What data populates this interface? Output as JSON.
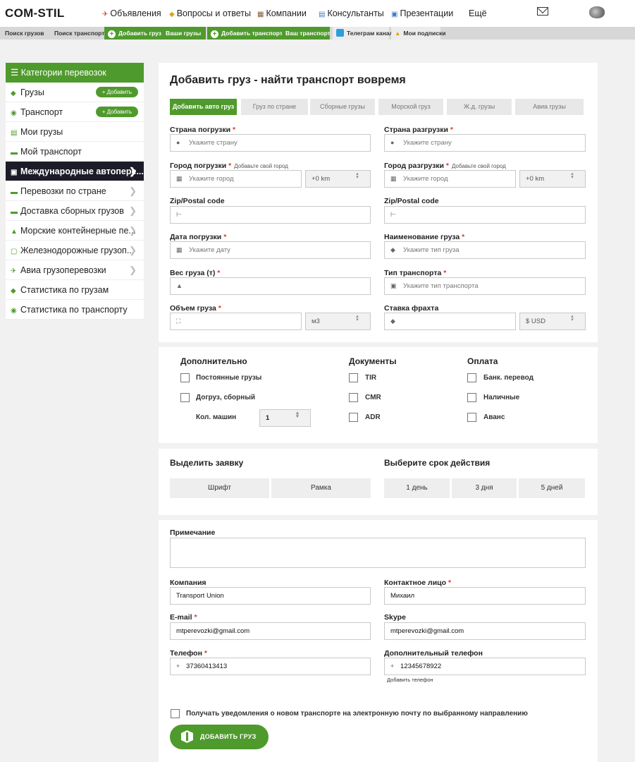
{
  "top_nav": {
    "logo": "COM-STIL",
    "items": [
      {
        "label": "Объявления",
        "icon": "megaphone-icon"
      },
      {
        "label": "Вопросы и ответы",
        "icon": "chat-icon"
      },
      {
        "label": "Компании",
        "icon": "building-icon"
      },
      {
        "label": "Консультанты",
        "icon": "consultant-icon"
      },
      {
        "label": "Презентации",
        "icon": "presentation-icon"
      }
    ],
    "more": "Ещё"
  },
  "sub_nav": {
    "items": [
      "Поиск грузов",
      "Поиск транспорта",
      "Добавить груз",
      "Ваши грузы",
      "Добавить транспорт",
      "Ваш транспорт",
      "Телеграм канал",
      "Мои подписки"
    ]
  },
  "sidebar": {
    "title": "Категории перевозок",
    "add_label": "+ Добавить",
    "items": [
      {
        "label": "Грузы"
      },
      {
        "label": "Транспорт"
      },
      {
        "label": "Мои грузы"
      },
      {
        "label": "Мой транспорт"
      },
      {
        "label": "Международные автопере..."
      },
      {
        "label": "Перевозки по стране"
      },
      {
        "label": "Доставка сборных грузов"
      },
      {
        "label": "Морские контейнерные пе..."
      },
      {
        "label": "Железнодорожные грузоп..."
      },
      {
        "label": "Авиа грузоперевозки"
      },
      {
        "label": "Статистика по грузам"
      },
      {
        "label": "Статистика по транспорту"
      }
    ]
  },
  "form": {
    "title": "Добавить груз - найти транспорт вовремя",
    "tabs": [
      "Добавить авто груз",
      "Груз по стране",
      "Сборные грузы",
      "Морской груз",
      "Ж.д. грузы",
      "Авиа грузы"
    ],
    "required_mark": "*",
    "add_city_hint": "Добавьте свой город",
    "fields": {
      "load_country": {
        "label": "Страна погрузки",
        "placeholder": "Укажите страну"
      },
      "unload_country": {
        "label": "Страна разгрузки",
        "placeholder": "Укажите страну"
      },
      "load_city": {
        "label": "Город погрузки",
        "placeholder": "Укажите город",
        "radius": "+0 km"
      },
      "unload_city": {
        "label": "Город разгрузки",
        "placeholder": "Укажите город",
        "radius": "+0 km"
      },
      "load_zip": {
        "label": "Zip/Postal code"
      },
      "unload_zip": {
        "label": "Zip/Postal code"
      },
      "load_date": {
        "label": "Дата погрузки",
        "placeholder": "Укажите дату"
      },
      "cargo_name": {
        "label": "Наименование груза",
        "placeholder": "Укажите тип груза"
      },
      "weight": {
        "label": "Вес груза (т)"
      },
      "transport_type": {
        "label": "Тип транспорта",
        "placeholder": "Укажите тип транспорта"
      },
      "volume": {
        "label": "Объем груза",
        "unit": "м3"
      },
      "rate": {
        "label": "Ставка фрахта",
        "currency": "$ USD"
      }
    }
  },
  "extras": {
    "additional": {
      "title": "Дополнительно",
      "options": [
        "Постоянные грузы",
        "Догруз, сборный"
      ],
      "cars_label": "Кол. машин",
      "cars_value": "1"
    },
    "documents": {
      "title": "Документы",
      "options": [
        "TIR",
        "CMR",
        "ADR"
      ]
    },
    "payment": {
      "title": "Оплата",
      "options": [
        "Банк. перевод",
        "Наличные",
        "Аванс"
      ]
    }
  },
  "highlight": {
    "title": "Выделить заявку",
    "options": [
      "Шрифт",
      "Рамка"
    ],
    "duration_title": "Выберите срок действия",
    "durations": [
      "1 день",
      "3 дня",
      "5 дней"
    ]
  },
  "contact": {
    "note_label": "Примечание",
    "note_value": "",
    "company": {
      "label": "Компания",
      "value": "Transport Union"
    },
    "contact_person": {
      "label": "Контактное лицо",
      "value": "Михаил"
    },
    "email": {
      "label": "E-mail",
      "value": "mtperevozki@gmail.com"
    },
    "skype": {
      "label": "Skype",
      "value": "mtperevozki@gmail.com"
    },
    "phone": {
      "label": "Телефон",
      "prefix": "+",
      "value": "37360413413"
    },
    "phone2": {
      "label": "Дополнительный телефон",
      "prefix": "+",
      "value": "12345678922"
    },
    "add_phone": "Добавить телефон",
    "notify_label": "Получать уведомления о новом транспорте на электронную почту по выбранному направлению",
    "submit_label": "ДОБАВИТЬ ГРУЗ"
  },
  "colors": {
    "accent": "#4f9a2c",
    "dark": "#1c1c28",
    "required": "#d93a2b",
    "telegram": "#29a0da"
  }
}
